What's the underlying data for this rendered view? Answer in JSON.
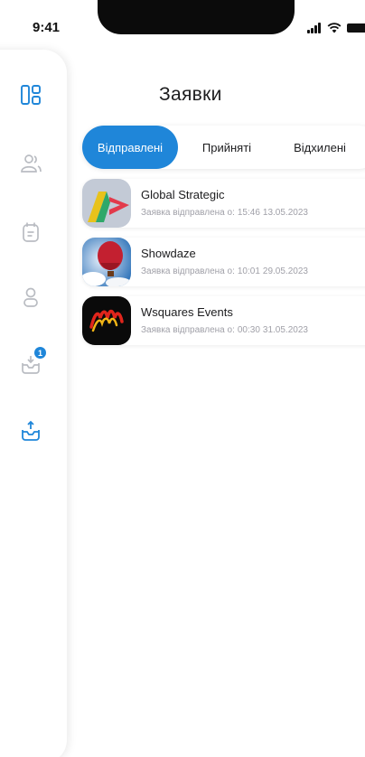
{
  "status_bar": {
    "time": "9:41"
  },
  "header": {
    "title": "Заявки"
  },
  "tabs": [
    {
      "label": "Відправлені",
      "active": true
    },
    {
      "label": "Прийняті",
      "active": false
    },
    {
      "label": "Відхилені",
      "active": false
    }
  ],
  "sidebar": {
    "items": [
      {
        "icon": "dashboard-icon",
        "active": true
      },
      {
        "icon": "users-icon",
        "active": false
      },
      {
        "icon": "calendar-note-icon",
        "active": false
      },
      {
        "icon": "profile-icon",
        "active": false
      },
      {
        "icon": "inbox-notifications-icon",
        "active": false,
        "badge": "1"
      },
      {
        "icon": "outbox-upload-icon",
        "active": true
      }
    ]
  },
  "requests": [
    {
      "name": "Global Strategic",
      "status_label": "Заявка відправлена о:",
      "time": "15:46",
      "date": "13.05.2023"
    },
    {
      "name": "Showdaze",
      "status_label": "Заявка відправлена о:",
      "time": "10:01",
      "date": "29.05.2023"
    },
    {
      "name": "Wsquares Events",
      "status_label": "Заявка відправлена о:",
      "time": "00:30",
      "date": "31.05.2023"
    }
  ],
  "colors": {
    "accent": "#1f86d9",
    "inactive_icon": "#b9bcc2",
    "text": "#1c1c1e",
    "subtext": "#a0a0a8"
  }
}
